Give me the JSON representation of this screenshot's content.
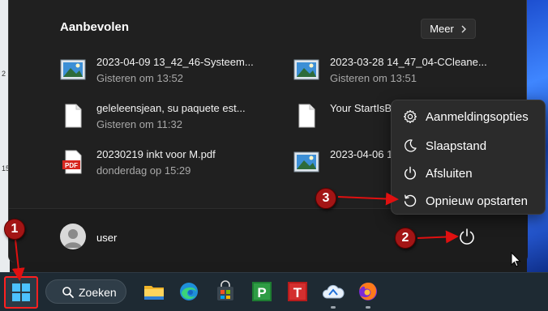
{
  "start_menu": {
    "section_title": "Aanbevolen",
    "more_button": "Meer",
    "recommended": [
      {
        "name": "2023-04-09 13_42_46-Systeem...",
        "time": "Gisteren om 13:52",
        "icon": "image-file-icon"
      },
      {
        "name": "2023-03-28 14_47_04-CCleane...",
        "time": "Gisteren om 13:51",
        "icon": "image-file-icon"
      },
      {
        "name": "geleleensjean, su paquete est...",
        "time": "Gisteren om 11:32",
        "icon": "document-file-icon"
      },
      {
        "name": "Your StartIsB",
        "time": "",
        "icon": "document-file-icon"
      },
      {
        "name": "20230219 inkt voor M.pdf",
        "time": "donderdag op 15:29",
        "icon": "pdf-file-icon"
      },
      {
        "name": "2023-04-06 1",
        "time": "",
        "icon": "image-file-icon"
      }
    ],
    "user_name": "user"
  },
  "power_menu": {
    "items": [
      {
        "label": "Aanmeldingsopties",
        "icon": "gear-icon"
      },
      {
        "label": "Slaapstand",
        "icon": "moon-icon"
      },
      {
        "label": "Afsluiten",
        "icon": "power-icon"
      },
      {
        "label": "Opnieuw opstarten",
        "icon": "restart-icon"
      }
    ]
  },
  "taskbar": {
    "search_label": "Zoeken",
    "apps": [
      "file-explorer-icon",
      "edge-icon",
      "store-icon",
      "p-app-icon",
      "t-app-icon",
      "cloud-app-icon",
      "firefox-icon"
    ]
  },
  "annotations": [
    "1",
    "2",
    "3"
  ],
  "pdf_badge": "PDF",
  "p_app_letter": "P",
  "t_app_letter": "T",
  "desktop_edge_labels": [
    "2",
    "15"
  ],
  "colors": {
    "menu_bg": "#202020",
    "flyout_bg": "#2b2b2b",
    "taskbar_bg": "#1e2a33",
    "annotation_red": "#a31515"
  }
}
